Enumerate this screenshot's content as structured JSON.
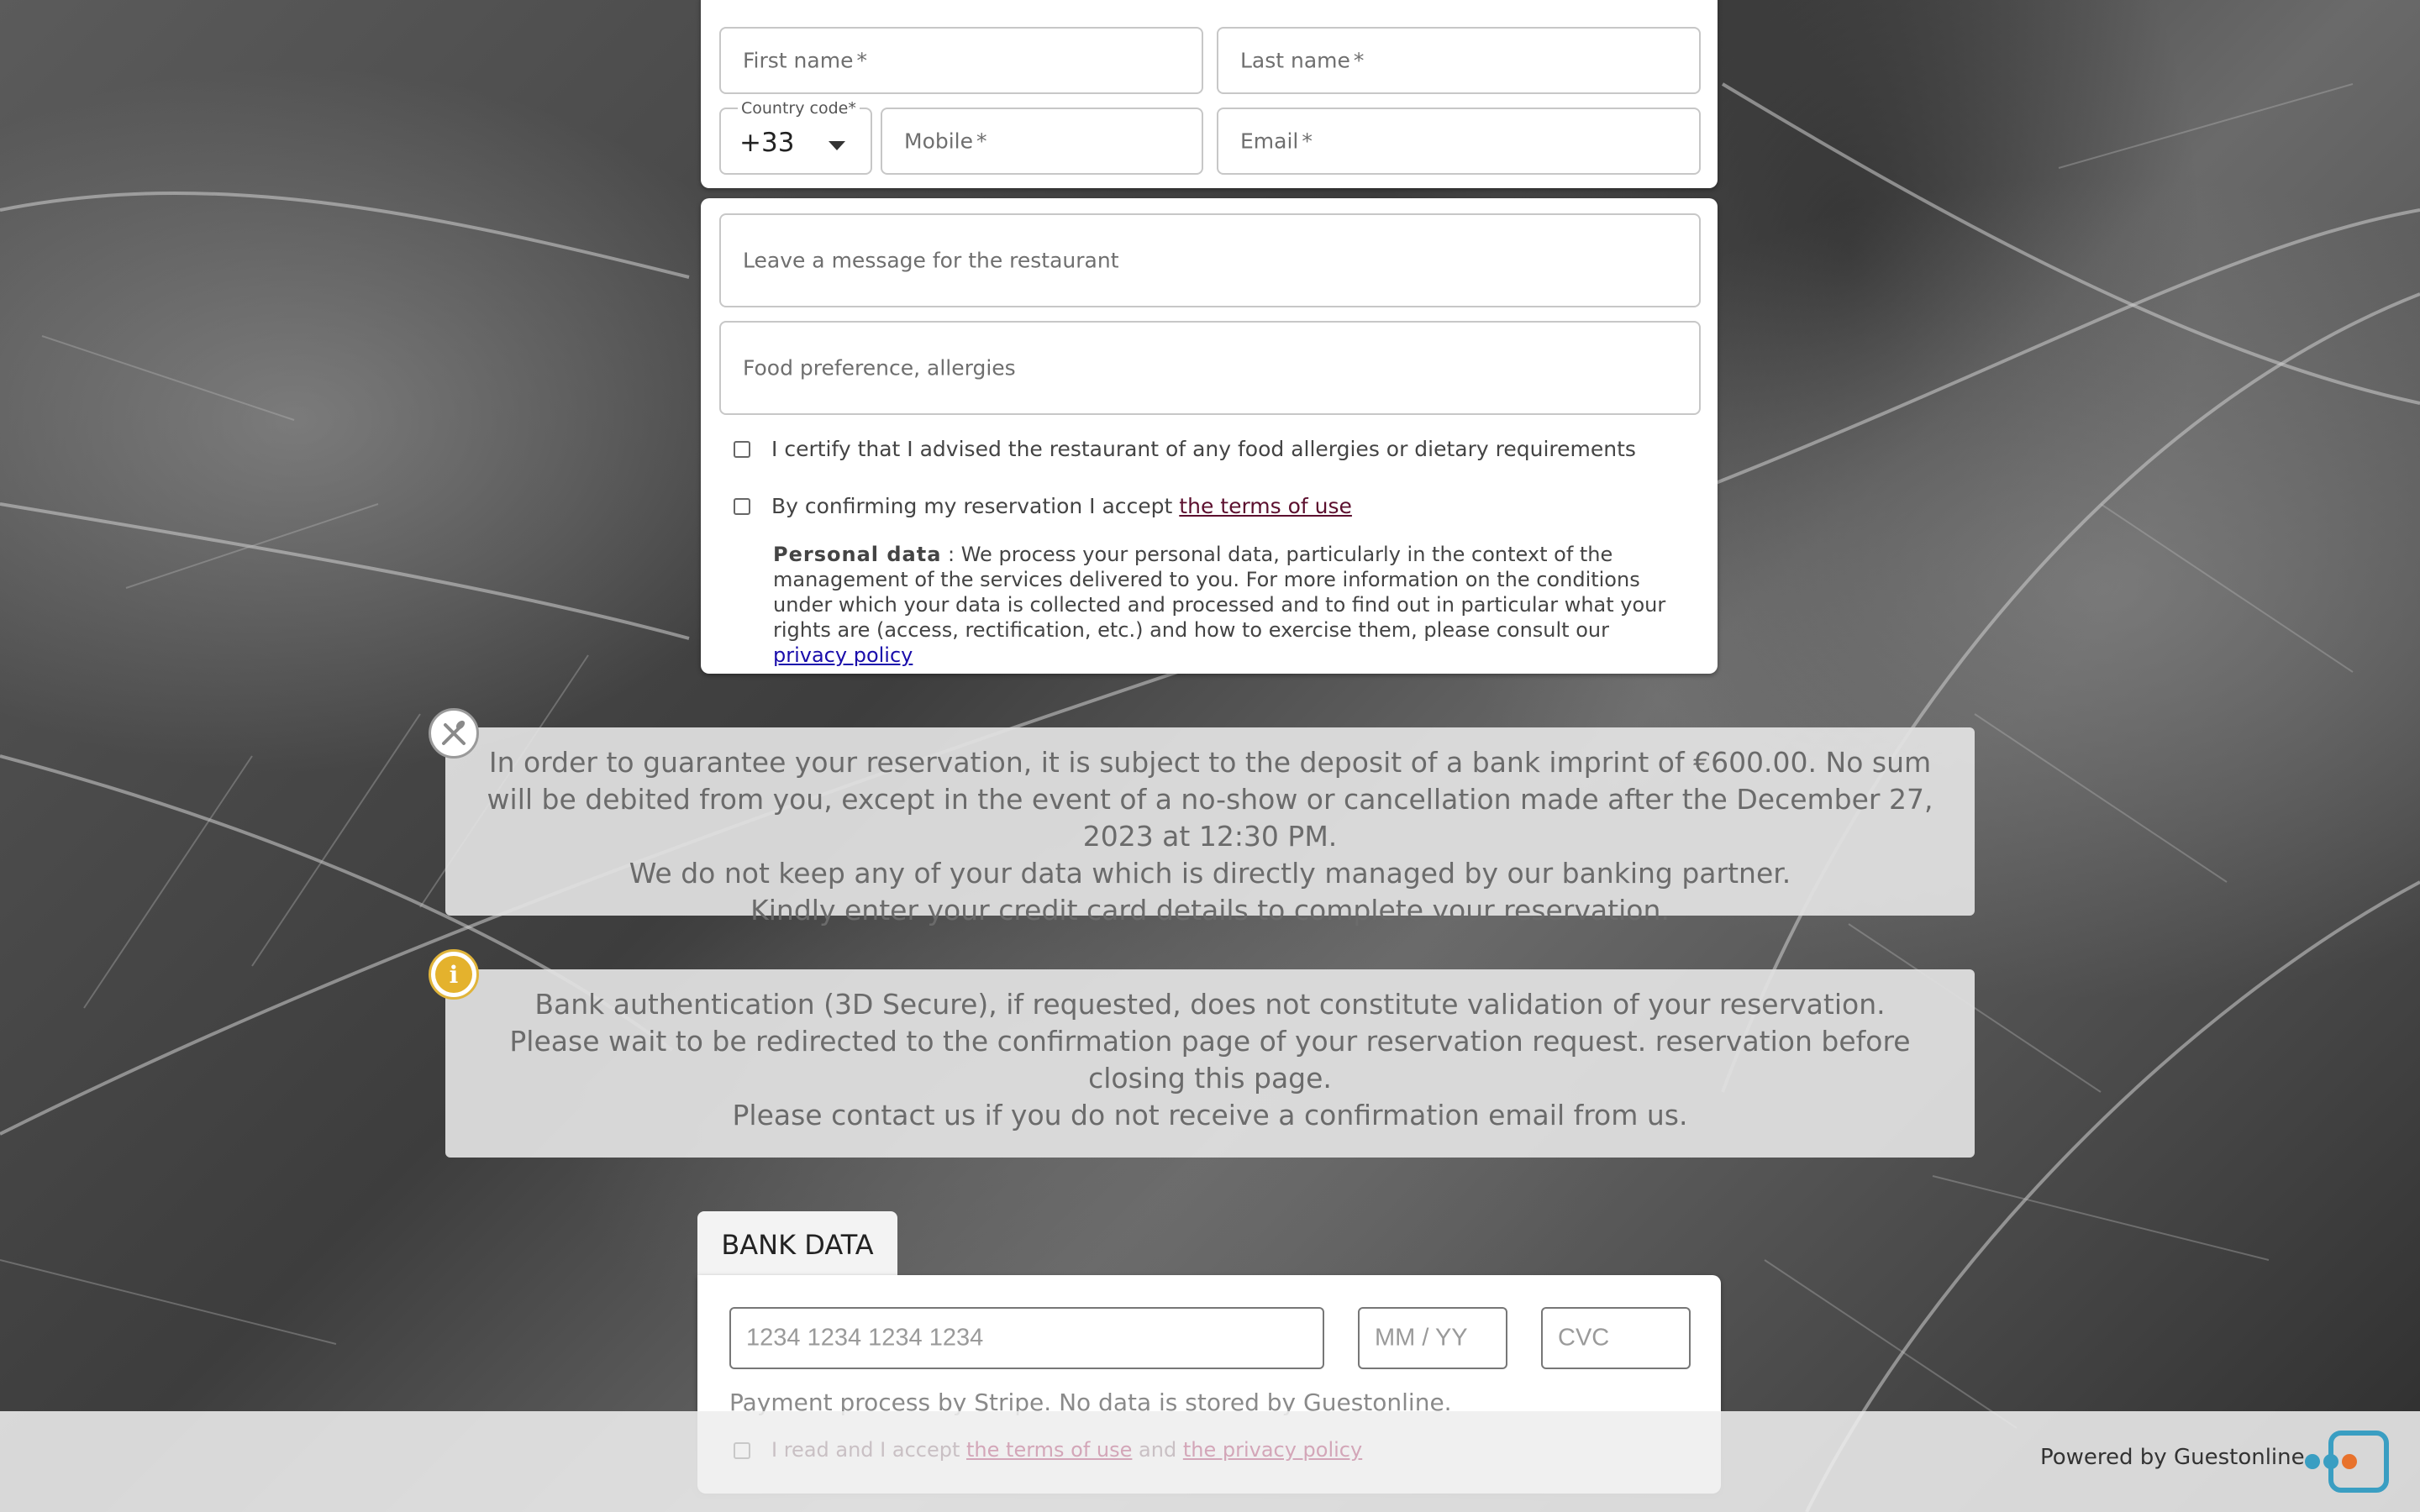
{
  "contact": {
    "first_name": "First name",
    "last_name": "Last name",
    "country_code_label": "Country code",
    "country_code_value": "+33",
    "mobile": "Mobile",
    "email": "Email",
    "required_mark": "*"
  },
  "extras": {
    "message_placeholder": "Leave a message for the restaurant",
    "food_placeholder": "Food preference, allergies",
    "allergy_certify": "I certify that I advised the restaurant of any food allergies or dietary requirements",
    "terms_prefix": "By confirming my reservation I accept ",
    "terms_link": "the terms of use",
    "personal_data_title": "Personal data",
    "personal_data_text": " : We process your personal data, particularly in the context of the management of the services delivered to you. For more information on the conditions under which your data is collected and processed and to find out in particular what your rights are (access, rectification, etc.) and how to exercise them, please consult our ",
    "privacy_link": "privacy policy"
  },
  "deposit_notice": {
    "line1": "In order to guarantee your reservation, it is subject to the deposit of a bank imprint of €600.00. No sum will be debited from you, except in the event of a no-show or cancellation made after the December 27, 2023 at 12:30 PM.",
    "line2": "We do not keep any of your data which is directly managed by our banking partner.",
    "line3": "Kindly enter your credit card details to complete your reservation."
  },
  "secure_notice": {
    "line1": "Bank authentication (3D Secure), if requested, does not constitute validation of your reservation.",
    "line2": "Please wait to be redirected to the confirmation page of your reservation request. reservation before closing this page.",
    "line3": "Please contact us if you do not receive a confirmation email from us."
  },
  "bank": {
    "tab_label": "BANK DATA",
    "card_placeholder": "1234 1234 1234 1234",
    "expiry_placeholder": "MM / YY",
    "cvc_placeholder": "CVC",
    "stripe_note": "Payment process by Stripe. No data is stored by Guestonline.",
    "accept_prefix": "I read and I accept ",
    "accept_terms": "the terms of use",
    "accept_and": " and ",
    "accept_privacy": "the privacy policy"
  },
  "footer": {
    "powered_by": "Powered by Guestonline"
  },
  "colors": {
    "link_terms": "#5c0f2e",
    "link_privacy": "#1a0dab",
    "info_icon": "#e4b22d",
    "logo_blue": "#3a9ec2",
    "logo_orange": "#e8722c"
  }
}
